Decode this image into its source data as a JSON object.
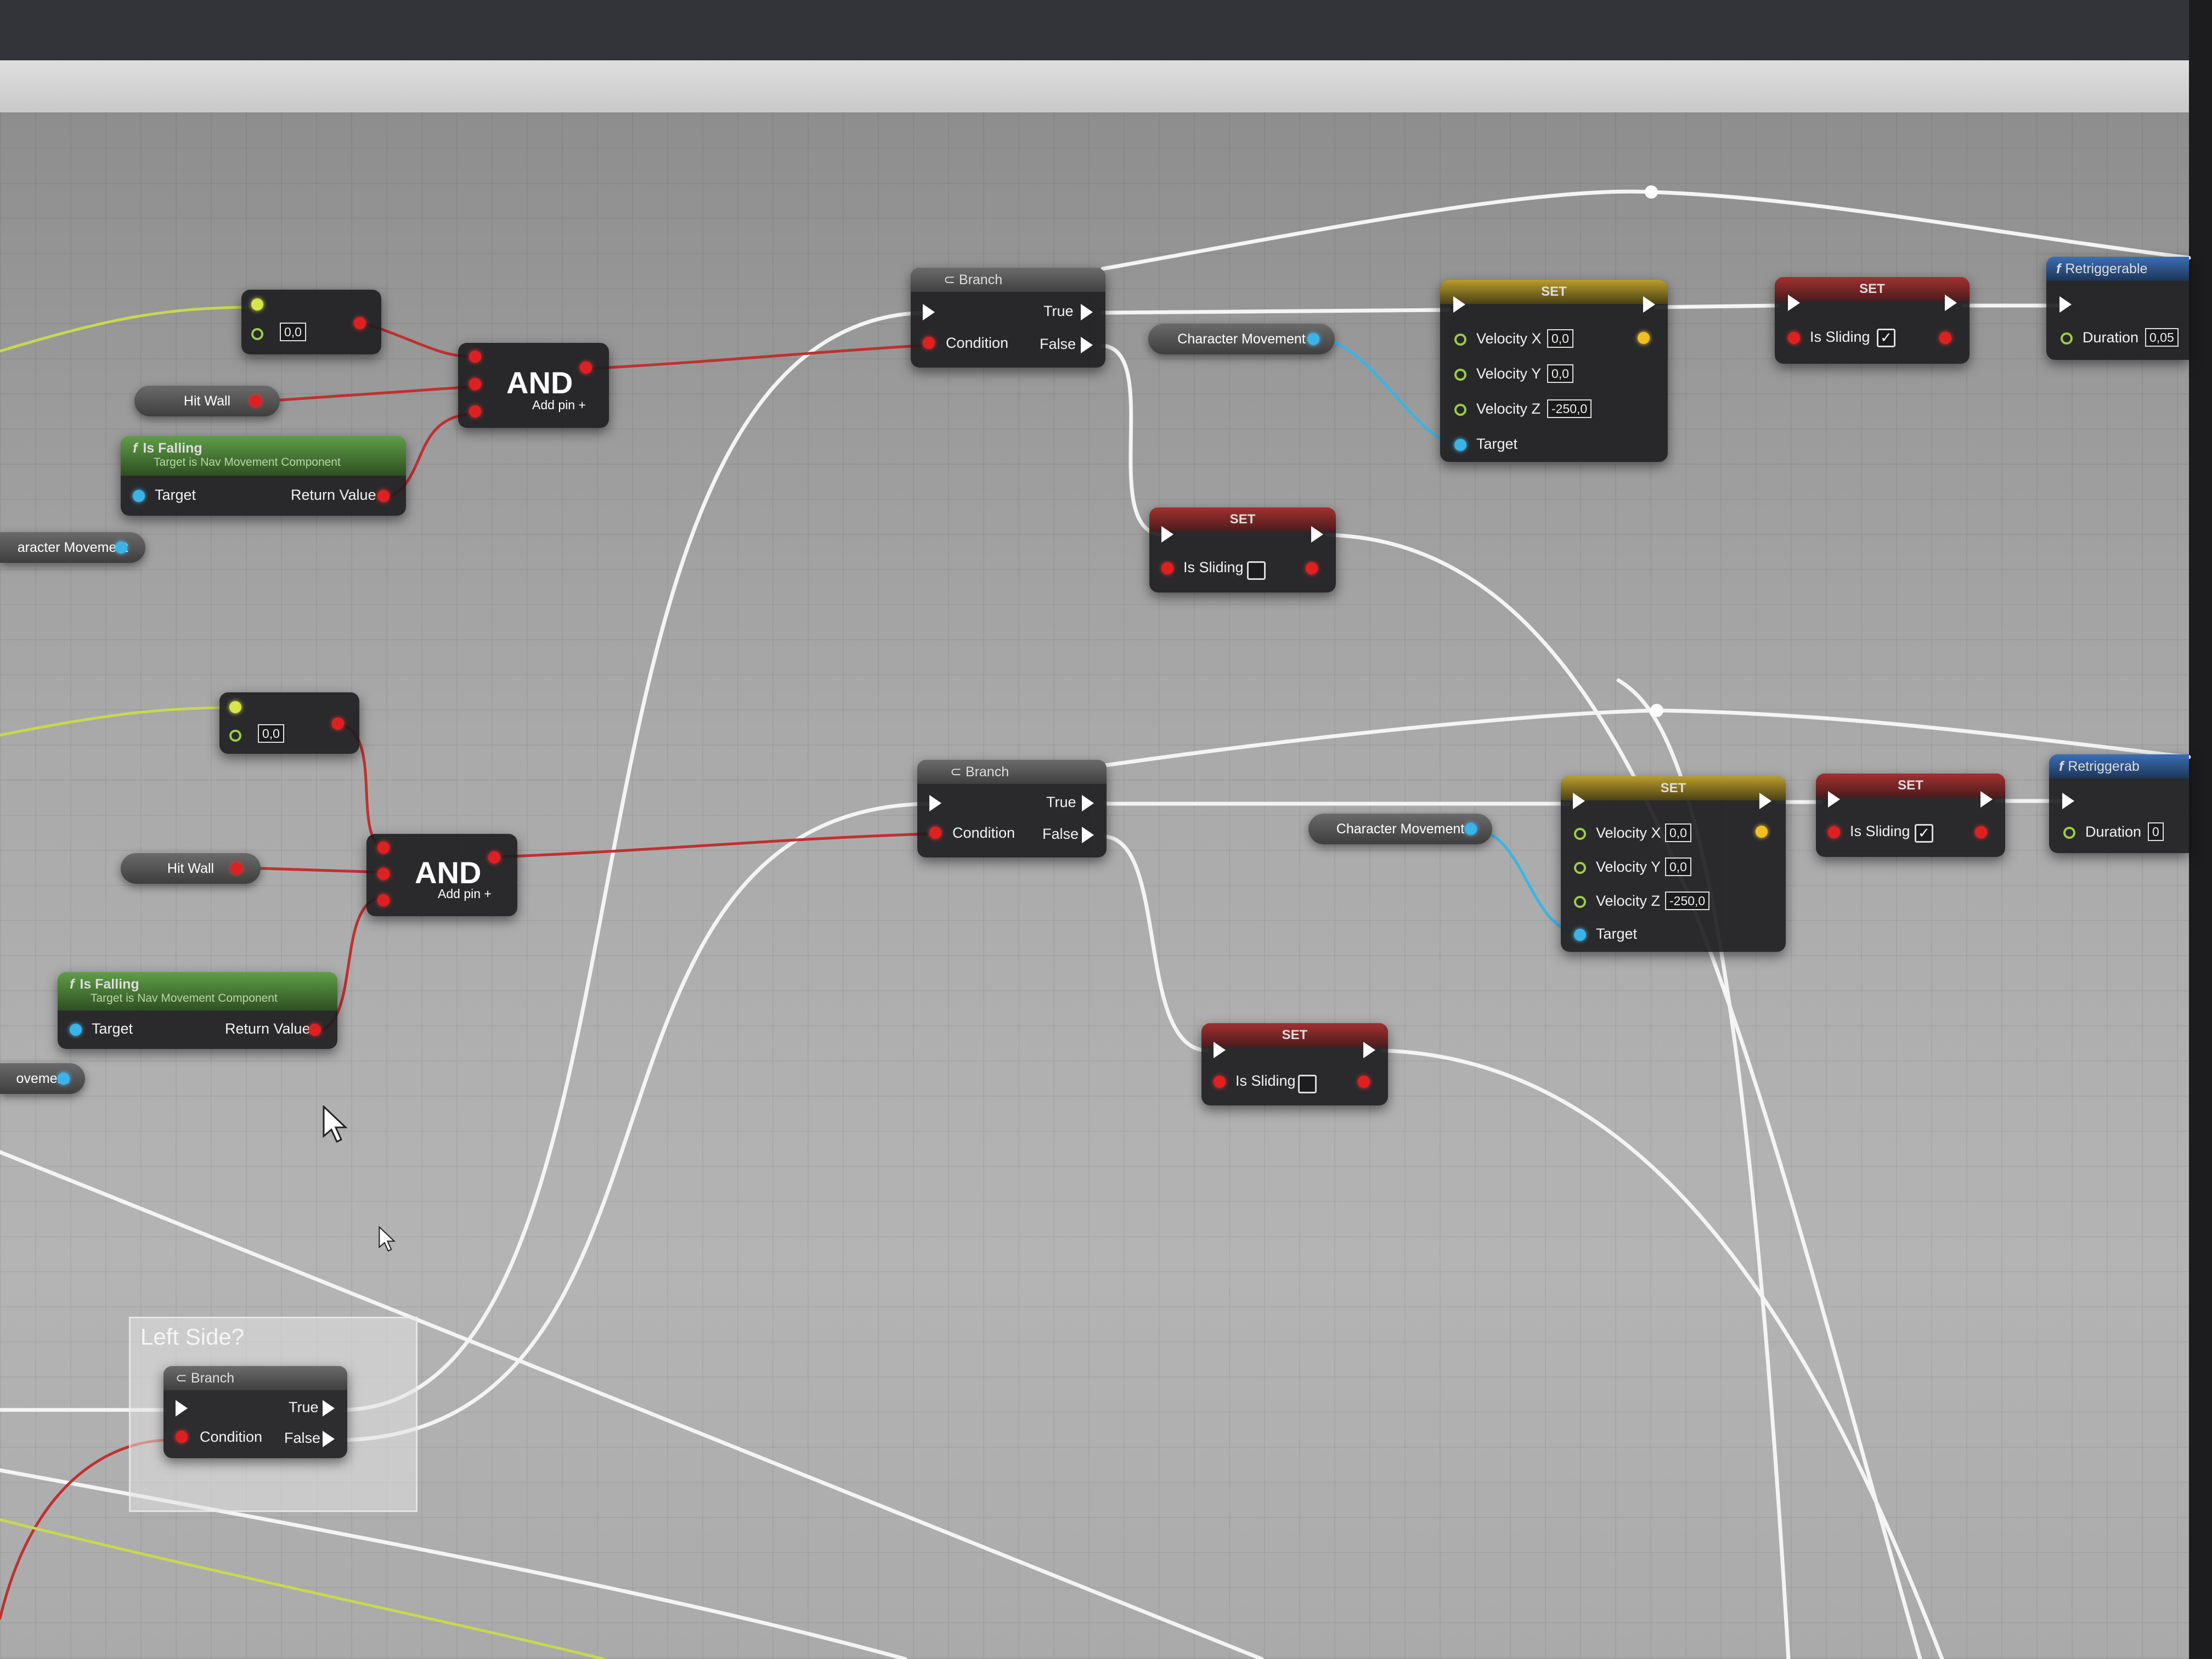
{
  "graph": {
    "row1": {
      "greater_value": "0,0",
      "hit_wall": "Hit Wall",
      "and": {
        "title": "AND",
        "add_pin": "Add pin"
      },
      "is_falling": {
        "title": "Is Falling",
        "subtitle": "Target is Nav Movement Component",
        "target": "Target",
        "return": "Return Value"
      },
      "char_move_left": "aracter Movement",
      "branch": {
        "title": "Branch",
        "true": "True",
        "false": "False",
        "condition": "Condition"
      },
      "char_move": "Character Movement",
      "set_velocity": {
        "title": "SET",
        "vx_label": "Velocity X",
        "vx": "0,0",
        "vy_label": "Velocity Y",
        "vy": "0,0",
        "vz_label": "Velocity Z",
        "vz": "-250,0",
        "target": "Target"
      },
      "set_sliding_true": {
        "title": "SET",
        "label": "Is Sliding",
        "checked": "✓"
      },
      "set_sliding_false": {
        "title": "SET",
        "label": "Is Sliding"
      },
      "retrigger": {
        "title": "Retriggerable",
        "duration": "Duration",
        "duration_val": "0,05"
      }
    },
    "row2": {
      "greater_value": "0,0",
      "hit_wall": "Hit Wall",
      "and": {
        "title": "AND",
        "add_pin": "Add pin"
      },
      "is_falling": {
        "title": "Is Falling",
        "subtitle": "Target is Nav Movement Component",
        "target": "Target",
        "return": "Return Value"
      },
      "char_move_left": "ovement",
      "branch": {
        "title": "Branch",
        "true": "True",
        "false": "False",
        "condition": "Condition"
      },
      "char_move": "Character Movement",
      "set_velocity": {
        "title": "SET",
        "vx_label": "Velocity X",
        "vx": "0,0",
        "vy_label": "Velocity Y",
        "vy": "0,0",
        "vz_label": "Velocity Z",
        "vz": "-250,0",
        "target": "Target"
      },
      "set_sliding_true": {
        "title": "SET",
        "label": "Is Sliding",
        "checked": "✓"
      },
      "set_sliding_false": {
        "title": "SET",
        "label": "Is Sliding"
      },
      "retrigger": {
        "title": "Retriggerab",
        "duration": "Duration",
        "duration_val": "0"
      }
    },
    "comment": {
      "title": "Left Side?",
      "branch": {
        "title": "Branch",
        "true": "True",
        "false": "False",
        "condition": "Condition"
      }
    }
  },
  "colors": {
    "exec": "#ffffff",
    "bool": "#e02020",
    "object": "#3ab4e8",
    "float": "#9ccc4a",
    "vector": "#f0c020"
  }
}
